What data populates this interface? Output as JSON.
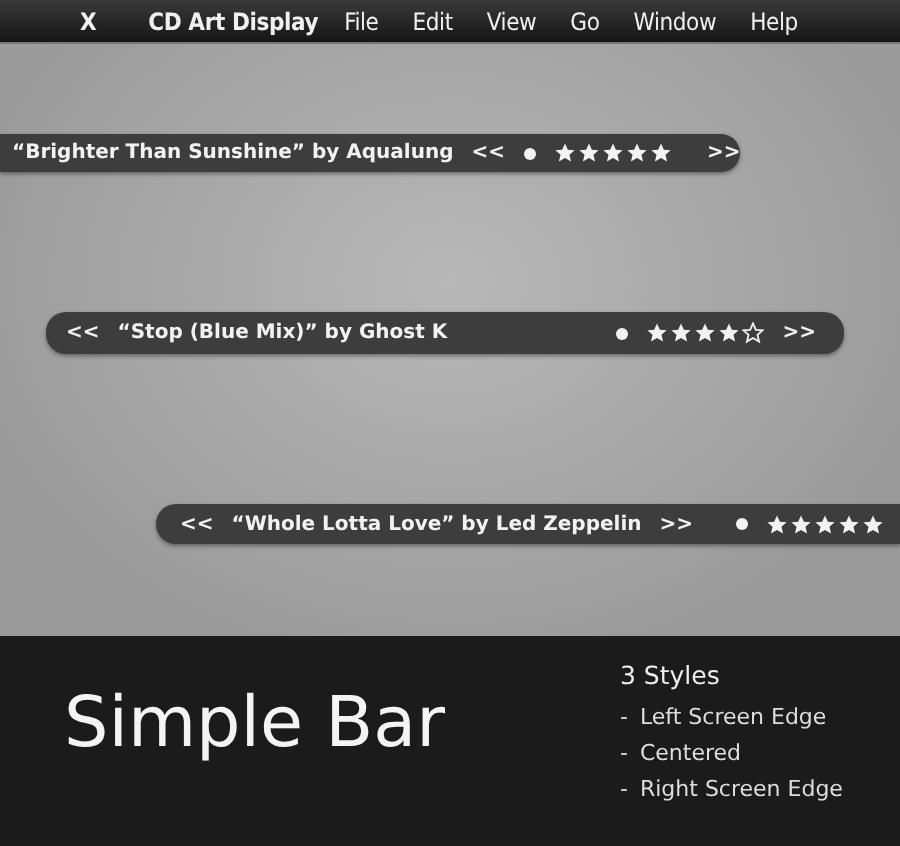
{
  "menu_bar": {
    "close": "X",
    "app_name": "CD Art Display",
    "items": [
      "File",
      "Edit",
      "View",
      "Go",
      "Window",
      "Help"
    ]
  },
  "bars": [
    {
      "kind": "left",
      "title": "“Brighter Than Sunshine” by Aqualung",
      "prev": "<<",
      "next": ">>",
      "stars": 5
    },
    {
      "kind": "centered",
      "title": "“Stop (Blue Mix)” by Ghost K",
      "prev": "<<",
      "next": ">>",
      "stars": 4
    },
    {
      "kind": "right",
      "title": "“Whole Lotta Love” by Led Zeppelin",
      "prev": "<<",
      "next": ">>",
      "stars": 5
    }
  ],
  "footer": {
    "title": "Simple Bar",
    "styles_heading": "3 Styles",
    "styles": [
      "Left Screen Edge",
      "Centered",
      "Right Screen Edge"
    ],
    "bullet": "-"
  }
}
